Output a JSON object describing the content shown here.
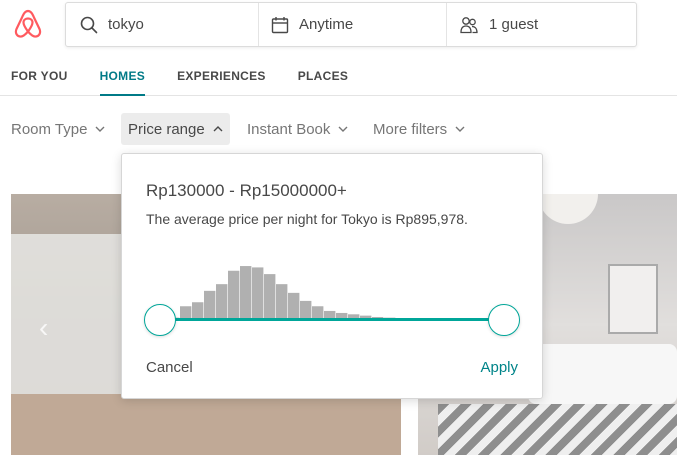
{
  "brand": {
    "logo_icon": "airbnb-logo-icon",
    "color": "#ff5a5f"
  },
  "search": {
    "query": "tokyo",
    "dates": "Anytime",
    "guests": "1 guest",
    "icons": {
      "search": "search-icon",
      "calendar": "calendar-icon",
      "guests": "guests-icon"
    }
  },
  "nav": {
    "tabs": [
      {
        "label": "FOR YOU",
        "active": false
      },
      {
        "label": "HOMES",
        "active": true
      },
      {
        "label": "EXPERIENCES",
        "active": false
      },
      {
        "label": "PLACES",
        "active": false
      }
    ],
    "active_color": "#007a87"
  },
  "filters": {
    "items": [
      {
        "label": "Room Type",
        "active": false
      },
      {
        "label": "Price range",
        "active": true
      },
      {
        "label": "Instant Book",
        "active": false
      },
      {
        "label": "More filters",
        "active": false
      }
    ]
  },
  "price_popover": {
    "range_text": "Rp130000 - Rp15000000+",
    "average_text": "The average price per night for Tokyo is Rp895,978.",
    "range": {
      "min_fraction": 0.0,
      "max_fraction": 1.0
    },
    "histogram_heights": [
      0.05,
      0.22,
      0.28,
      0.45,
      0.55,
      0.75,
      0.82,
      0.8,
      0.7,
      0.55,
      0.42,
      0.3,
      0.22,
      0.15,
      0.12,
      0.1,
      0.08,
      0.06,
      0.05,
      0.04,
      0.02,
      0.03,
      0.02,
      0.02,
      0.02
    ],
    "histogram_color": "#b0b0b0",
    "track_color": "#00a699",
    "cancel_label": "Cancel",
    "apply_label": "Apply",
    "apply_color": "#008489"
  }
}
